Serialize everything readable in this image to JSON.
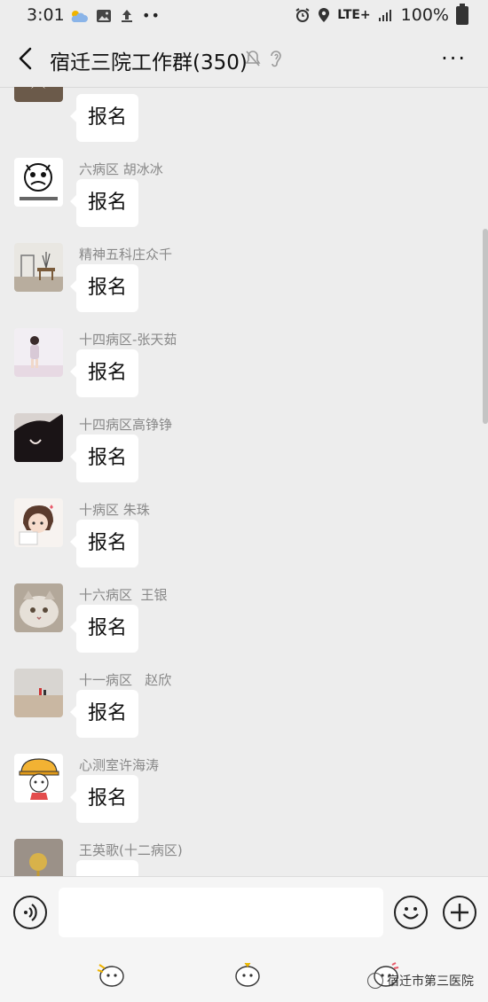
{
  "status_bar": {
    "time": "3:01",
    "left_icons": [
      "cloud-sun-icon",
      "image-icon",
      "upload-icon",
      "more-dots-icon"
    ],
    "network": "LTE+",
    "battery": "100%"
  },
  "header": {
    "title": "宿迁三院工作群(350)",
    "more": "···"
  },
  "messages": [
    {
      "sender": "",
      "text": "报名"
    },
    {
      "sender": "六病区 胡冰冰",
      "text": "报名"
    },
    {
      "sender": "精神五科庄众千",
      "text": "报名"
    },
    {
      "sender": "十四病区-张天茹",
      "text": "报名"
    },
    {
      "sender": "十四病区高铮铮",
      "text": "报名"
    },
    {
      "sender": "十病区 朱珠",
      "text": "报名"
    },
    {
      "sender": "十六病区  王银",
      "text": "报名"
    },
    {
      "sender": "十一病区   赵欣",
      "text": "报名"
    },
    {
      "sender": "心测室许海涛",
      "text": "报名"
    },
    {
      "sender": "王英歌(十二病区)",
      "text": ""
    }
  ],
  "input": {
    "value": "",
    "placeholder": ""
  },
  "watermark": {
    "text": "宿迁市第三医院"
  }
}
